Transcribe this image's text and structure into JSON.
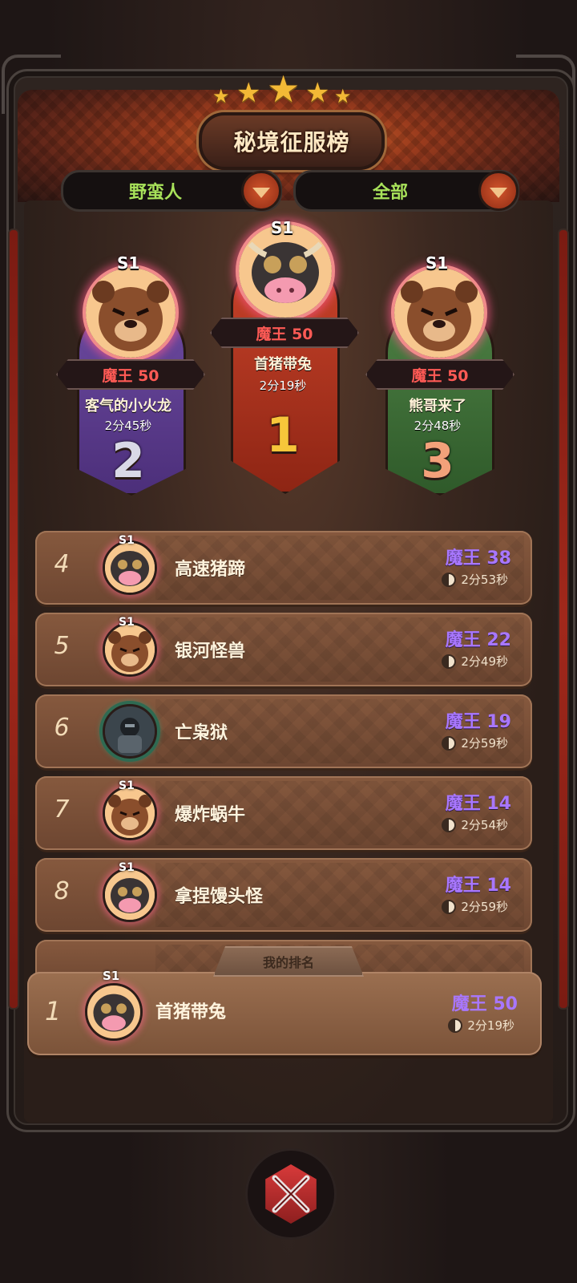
{
  "header": {
    "title": "秘境征服榜",
    "filter_class": "野蛮人",
    "filter_scope": "全部"
  },
  "podium": [
    {
      "rank": "2",
      "season": "S1",
      "level": "魔王 50",
      "name": "客气的小火龙",
      "time": "2分45秒",
      "color": "#5b3c8f",
      "number_color": "#d9d9e6"
    },
    {
      "rank": "1",
      "season": "S1",
      "level": "魔王 50",
      "name": "首猪带兔",
      "time": "2分19秒",
      "color": "#b1361e",
      "number_color": "#f7c63a"
    },
    {
      "rank": "3",
      "season": "S1",
      "level": "魔王 50",
      "name": "熊哥来了",
      "time": "2分48秒",
      "color": "#3f6b36",
      "number_color": "#f2a17a"
    }
  ],
  "rows": [
    {
      "rank": "4",
      "season": "S1",
      "name": "高速猪蹄",
      "level": "魔王 38",
      "time": "2分53秒",
      "avatar": "cow-avatar-icon"
    },
    {
      "rank": "5",
      "season": "S1",
      "name": "银河怪兽",
      "level": "魔王 22",
      "time": "2分49秒",
      "avatar": "bear-avatar-icon"
    },
    {
      "rank": "6",
      "season": "",
      "name": "亡枭狱",
      "level": "魔王 19",
      "time": "2分59秒",
      "avatar": "knight-avatar-icon"
    },
    {
      "rank": "7",
      "season": "S1",
      "name": "爆炸蜗牛",
      "level": "魔王 14",
      "time": "2分54秒",
      "avatar": "bear-avatar-icon"
    },
    {
      "rank": "8",
      "season": "S1",
      "name": "拿捏馒头怪",
      "level": "魔王 14",
      "time": "2分59秒",
      "avatar": "cow-avatar-icon"
    }
  ],
  "my_rank": {
    "tag": "我的排名",
    "rank": "1",
    "season": "S1",
    "name": "首猪带兔",
    "level": "魔王 50",
    "time": "2分19秒"
  },
  "colors": {
    "accent": "#a877ff",
    "level_red": "#ff5a55",
    "filter_green": "#a8e25a"
  }
}
